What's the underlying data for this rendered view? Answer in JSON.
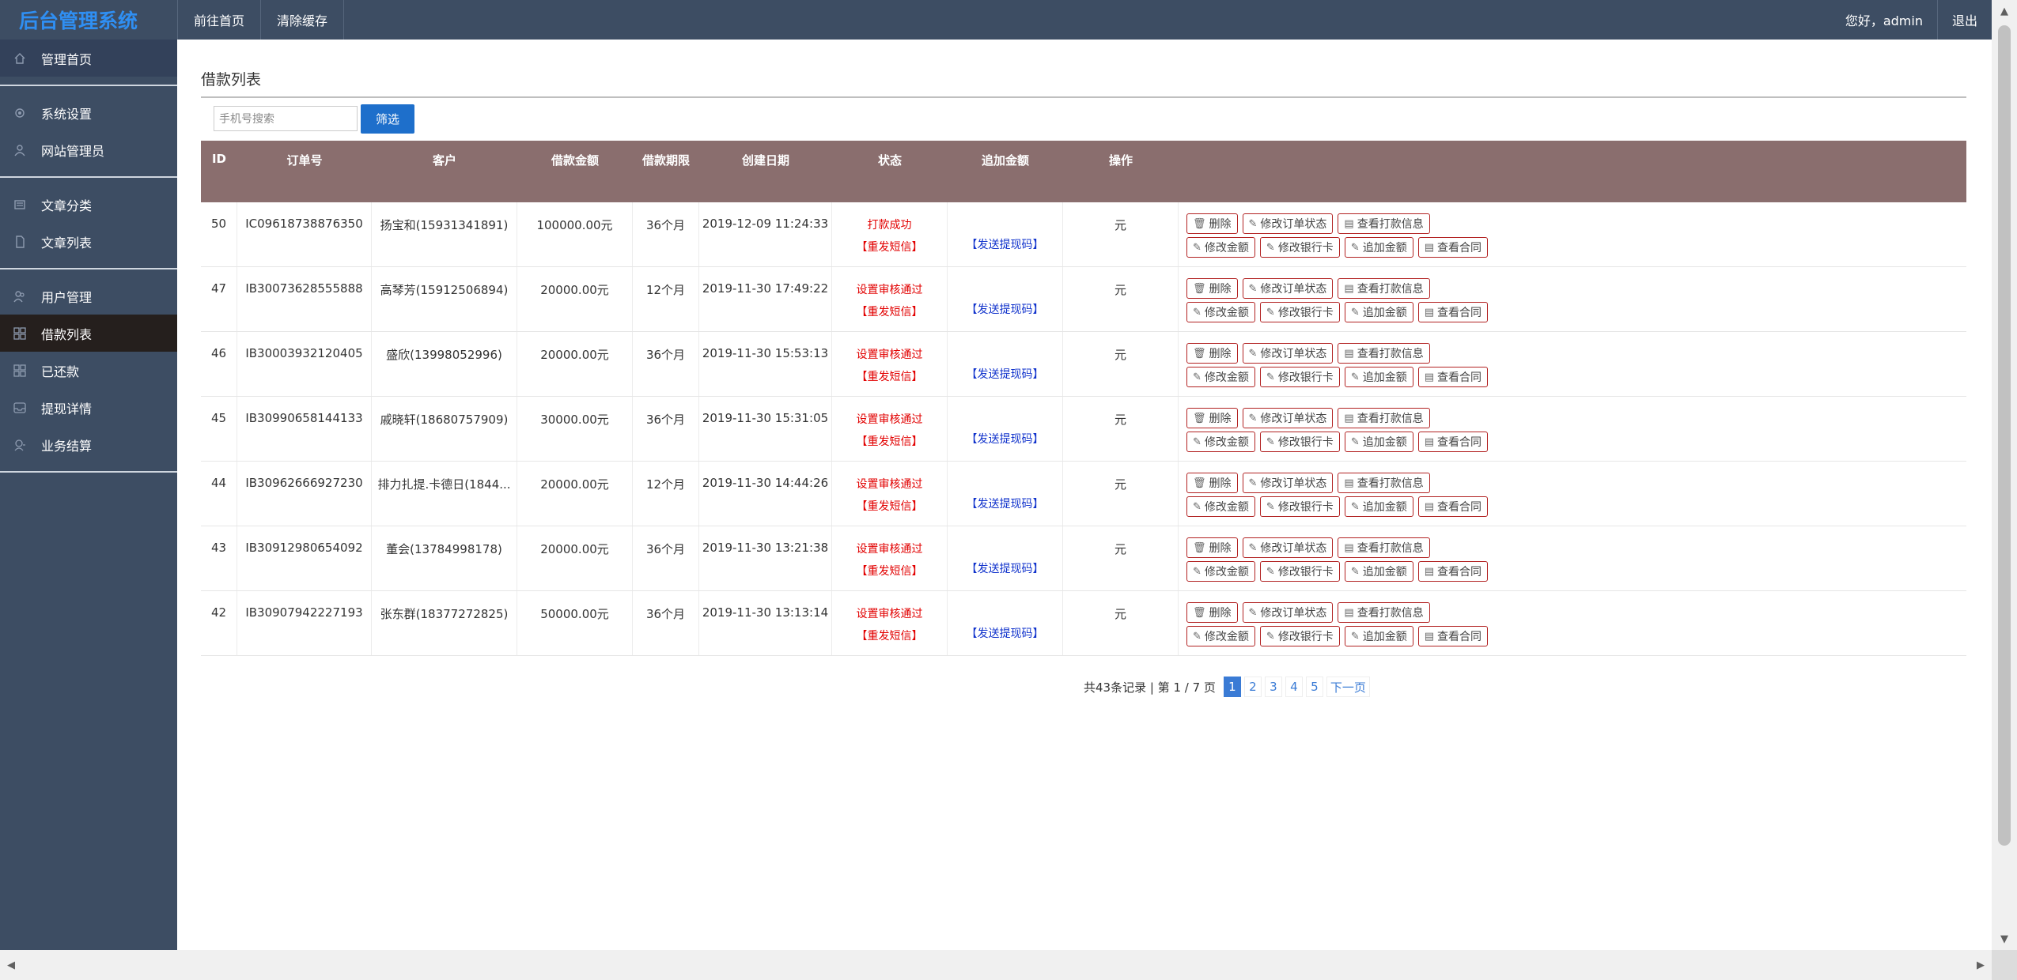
{
  "header": {
    "brand": "后台管理系统",
    "nav": [
      "前往首页",
      "清除缓存"
    ],
    "greeting": "您好，admin",
    "logout": "退出"
  },
  "sidebar": {
    "items": [
      {
        "label": "管理首页",
        "icon": "home-icon"
      },
      {
        "label": "系统设置",
        "icon": "gear-icon"
      },
      {
        "label": "网站管理员",
        "icon": "user-icon"
      },
      {
        "label": "文章分类",
        "icon": "list-icon"
      },
      {
        "label": "文章列表",
        "icon": "document-icon"
      },
      {
        "label": "用户管理",
        "icon": "users-icon"
      },
      {
        "label": "借款列表",
        "icon": "grid-icon"
      },
      {
        "label": "已还款",
        "icon": "grid-icon"
      },
      {
        "label": "提现详情",
        "icon": "inbox-icon"
      },
      {
        "label": "业务结算",
        "icon": "settle-icon"
      }
    ]
  },
  "main": {
    "title": "借款列表",
    "search_placeholder": "手机号搜索",
    "filter_button": "筛选",
    "columns": [
      "ID",
      "订单号",
      "客户",
      "借款金额",
      "借款期限",
      "创建日期",
      "状态",
      "追加金额",
      "操作"
    ],
    "rows": [
      {
        "id": "50",
        "order": "IC09618738876350",
        "customer": "扬宝和(15931341891)",
        "amount": "100000.00元",
        "term": "36个月",
        "date": "2019-12-09 11:24:33",
        "status": "打款成功"
      },
      {
        "id": "47",
        "order": "IB30073628555888",
        "customer": "高琴芳(15912506894)",
        "amount": "20000.00元",
        "term": "12个月",
        "date": "2019-11-30 17:49:22",
        "status": "设置审核通过"
      },
      {
        "id": "46",
        "order": "IB30003932120405",
        "customer": "盛欣(13998052996)",
        "amount": "20000.00元",
        "term": "36个月",
        "date": "2019-11-30 15:53:13",
        "status": "设置审核通过"
      },
      {
        "id": "45",
        "order": "IB30990658144133",
        "customer": "戚晓轩(18680757909)",
        "amount": "30000.00元",
        "term": "36个月",
        "date": "2019-11-30 15:31:05",
        "status": "设置审核通过"
      },
      {
        "id": "44",
        "order": "IB30962666927230",
        "customer": "排力扎提.卡德日(1844...",
        "amount": "20000.00元",
        "term": "12个月",
        "date": "2019-11-30 14:44:26",
        "status": "设置审核通过"
      },
      {
        "id": "43",
        "order": "IB30912980654092",
        "customer": "董会(13784998178)",
        "amount": "20000.00元",
        "term": "36个月",
        "date": "2019-11-30 13:21:38",
        "status": "设置审核通过"
      },
      {
        "id": "42",
        "order": "IB30907942227193",
        "customer": "张东群(18377272825)",
        "amount": "50000.00元",
        "term": "36个月",
        "date": "2019-11-30 13:13:14",
        "status": "设置审核通过"
      }
    ],
    "resend_sms": "【重发短信】",
    "send_code": "【发送提现码】",
    "unit": "元",
    "ops_row1": [
      "删除",
      "修改订单状态",
      "查看打款信息"
    ],
    "ops_row2": [
      "修改金额",
      "修改银行卡",
      "追加金额",
      "查看合同"
    ]
  },
  "pagination": {
    "summary": "共43条记录 | 第 1 / 7 页",
    "pages": [
      "1",
      "2",
      "3",
      "4",
      "5"
    ],
    "next": "下一页",
    "current": "1"
  },
  "colors": {
    "header_bg": "#3d4d63",
    "brand": "#2f8ff3",
    "table_head": "#8a6e6e",
    "status_red": "#e20000",
    "link_blue": "#1133cc",
    "accent": "#1e6fcb"
  }
}
